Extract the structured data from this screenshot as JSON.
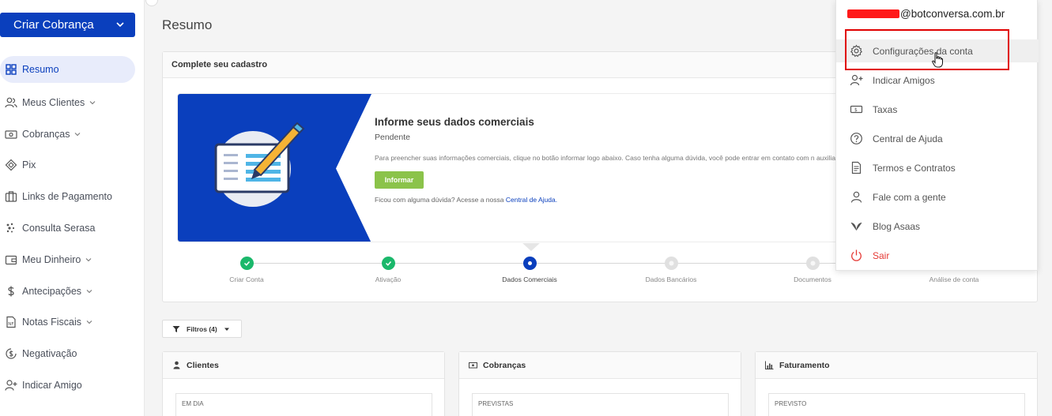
{
  "sidebar": {
    "cta_label": "Criar Cobrança",
    "items": [
      {
        "label": "Resumo",
        "icon": "dashboard-icon",
        "active": true,
        "has_caret": false
      },
      {
        "label": "Meus Clientes",
        "icon": "users-icon",
        "active": false,
        "has_caret": true
      },
      {
        "label": "Cobranças",
        "icon": "money-icon",
        "active": false,
        "has_caret": true
      },
      {
        "label": "Pix",
        "icon": "pix-icon",
        "active": false,
        "has_caret": false
      },
      {
        "label": "Links de Pagamento",
        "icon": "link-icon",
        "active": false,
        "has_caret": false
      },
      {
        "label": "Consulta Serasa",
        "icon": "serasa-icon",
        "active": false,
        "has_caret": false
      },
      {
        "label": "Meu Dinheiro",
        "icon": "wallet-icon",
        "active": false,
        "has_caret": true
      },
      {
        "label": "Antecipações",
        "icon": "dollar-icon",
        "active": false,
        "has_caret": true
      },
      {
        "label": "Notas Fiscais",
        "icon": "invoice-icon",
        "active": false,
        "has_caret": true
      },
      {
        "label": "Negativação",
        "icon": "negativacao-icon",
        "active": false,
        "has_caret": false
      },
      {
        "label": "Indicar Amigo",
        "icon": "add-user-icon",
        "active": false,
        "has_caret": false
      }
    ]
  },
  "main": {
    "title": "Resumo",
    "card_title": "Complete seu cadastro",
    "banner": {
      "title": "Informe seus dados comerciais",
      "status": "Pendente",
      "description": "Para preencher suas informações comerciais, clique no botão informar logo abaixo. Caso tenha alguma dúvida, você pode entrar em contato com n auxiliar.",
      "button_label": "Informar",
      "help_text": "Ficou com alguma dúvida? Acesse a nossa",
      "help_link": "Central de Ajuda."
    },
    "steps": [
      {
        "label": "Criar Conta",
        "state": "done"
      },
      {
        "label": "Ativação",
        "state": "done"
      },
      {
        "label": "Dados Comerciais",
        "state": "current"
      },
      {
        "label": "Dados Bancários",
        "state": "todo"
      },
      {
        "label": "Documentos",
        "state": "todo"
      },
      {
        "label": "Análise de conta",
        "state": "todo"
      }
    ],
    "filter_label": "Filtros (4)",
    "panels": [
      {
        "title": "Clientes",
        "icon": "person-icon",
        "sub": "EM DIA"
      },
      {
        "title": "Cobranças",
        "icon": "money-icon",
        "sub": "PREVISTAS"
      },
      {
        "title": "Faturamento",
        "icon": "bar-chart-icon",
        "sub": "PREVISTO"
      }
    ]
  },
  "account_menu": {
    "email_suffix": "@botconversa.com.br",
    "items": [
      {
        "label": "Configurações da conta",
        "icon": "gear-icon"
      },
      {
        "label": "Indicar Amigos",
        "icon": "add-user-icon"
      },
      {
        "label": "Taxas",
        "icon": "money-icon"
      },
      {
        "label": "Central de Ajuda",
        "icon": "help-icon"
      },
      {
        "label": "Termos e Contratos",
        "icon": "document-icon"
      },
      {
        "label": "Fale com a gente",
        "icon": "person-icon"
      },
      {
        "label": "Blog Asaas",
        "icon": "blog-icon"
      },
      {
        "label": "Sair",
        "icon": "power-icon"
      }
    ]
  },
  "colors": {
    "brand": "#0a3fbd",
    "success": "#1bb86b",
    "button_green": "#8bc34a",
    "danger": "#e53935",
    "highlight": "#e00000"
  }
}
